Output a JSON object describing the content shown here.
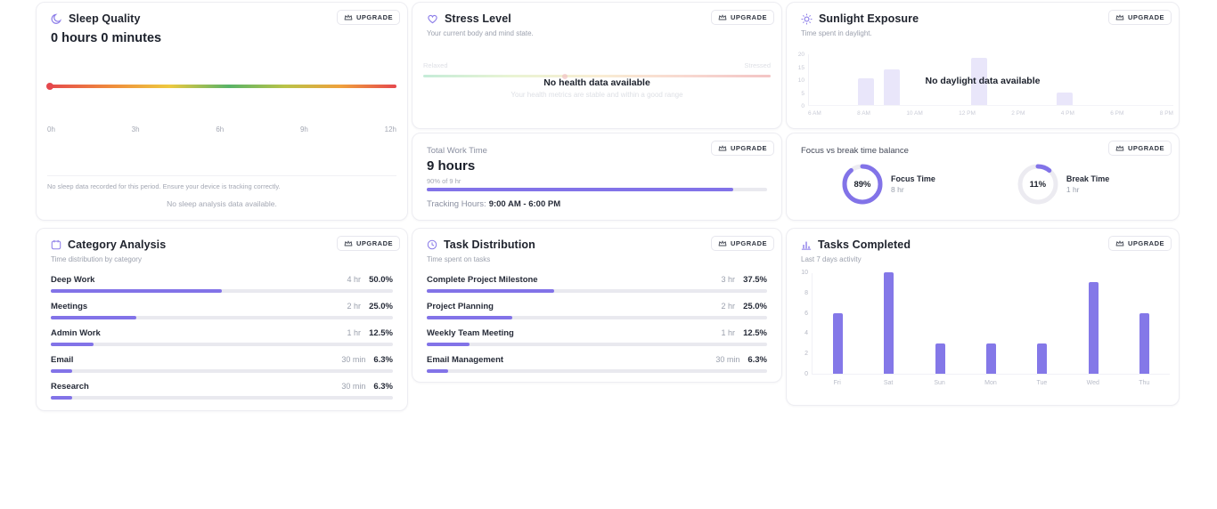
{
  "accent": "#8273e8",
  "upgrade_label": "UPGRADE",
  "sleep": {
    "title": "Sleep Quality",
    "value": "0 hours 0 minutes",
    "axis_labels": [
      "0h",
      "3h",
      "6h",
      "9h",
      "12h"
    ],
    "footer_note": "No sleep data recorded for this period. Ensure your device is tracking correctly.",
    "empty_message": "No sleep analysis data available."
  },
  "stress": {
    "title": "Stress Level",
    "subtitle": "Your current body and mind state.",
    "scale_min_label": "Relaxed",
    "scale_max_label": "Stressed",
    "overlay_title": "No health data available",
    "overlay_subtitle": "Your health metrics are stable and within a good range"
  },
  "sunlight": {
    "title": "Sunlight Exposure",
    "subtitle": "Time spent in daylight.",
    "overlay_title": "No daylight data available",
    "chart": {
      "type": "bar",
      "y_ticks": [
        "20",
        "15",
        "10",
        "5",
        "0"
      ],
      "x_labels": [
        "6 AM",
        "8 AM",
        "10 AM",
        "12 PM",
        "2 PM",
        "4 PM",
        "6 PM",
        "8 PM"
      ],
      "bars": [
        {
          "x_pct": 13.5,
          "h_pct": 53
        },
        {
          "x_pct": 20.5,
          "h_pct": 71
        },
        {
          "x_pct": 44.5,
          "h_pct": 93
        },
        {
          "x_pct": 68.0,
          "h_pct": 24
        }
      ]
    }
  },
  "work": {
    "label": "Total Work Time",
    "value": "9 hours",
    "progress_caption": "90% of 9 hr",
    "progress_pct": 90,
    "tracking_label": "Tracking Hours:",
    "tracking_value": "9:00 AM - 6:00 PM"
  },
  "balance": {
    "label": "Focus vs break time balance",
    "donuts": [
      {
        "pct_label": "89%",
        "value": 89,
        "title": "Focus Time",
        "subtitle": "8 hr"
      },
      {
        "pct_label": "11%",
        "value": 11,
        "title": "Break Time",
        "subtitle": "1 hr"
      }
    ]
  },
  "category": {
    "title": "Category Analysis",
    "subtitle": "Time distribution by category",
    "rows": [
      {
        "label": "Deep Work",
        "time": "4 hr",
        "pct_label": "50.0%",
        "pct": 50
      },
      {
        "label": "Meetings",
        "time": "2 hr",
        "pct_label": "25.0%",
        "pct": 25
      },
      {
        "label": "Admin Work",
        "time": "1 hr",
        "pct_label": "12.5%",
        "pct": 12.5
      },
      {
        "label": "Email",
        "time": "30 min",
        "pct_label": "6.3%",
        "pct": 6.3
      },
      {
        "label": "Research",
        "time": "30 min",
        "pct_label": "6.3%",
        "pct": 6.3
      }
    ]
  },
  "tasks": {
    "title": "Task Distribution",
    "subtitle": "Time spent on tasks",
    "rows": [
      {
        "label": "Complete Project Milestone",
        "time": "3 hr",
        "pct_label": "37.5%",
        "pct": 37.5
      },
      {
        "label": "Project Planning",
        "time": "2 hr",
        "pct_label": "25.0%",
        "pct": 25
      },
      {
        "label": "Weekly Team Meeting",
        "time": "1 hr",
        "pct_label": "12.5%",
        "pct": 12.5
      },
      {
        "label": "Email Management",
        "time": "30 min",
        "pct_label": "6.3%",
        "pct": 6.3
      }
    ]
  },
  "completed": {
    "title": "Tasks Completed",
    "subtitle": "Last 7 days activity",
    "chart": {
      "type": "bar",
      "categories": [
        "Fri",
        "Sat",
        "Sun",
        "Mon",
        "Tue",
        "Wed",
        "Thu"
      ],
      "values": [
        6,
        10,
        3,
        3,
        3,
        9,
        6
      ],
      "y_ticks": [
        10,
        8,
        6,
        4,
        2,
        0
      ],
      "ylim": [
        0,
        10
      ]
    }
  }
}
